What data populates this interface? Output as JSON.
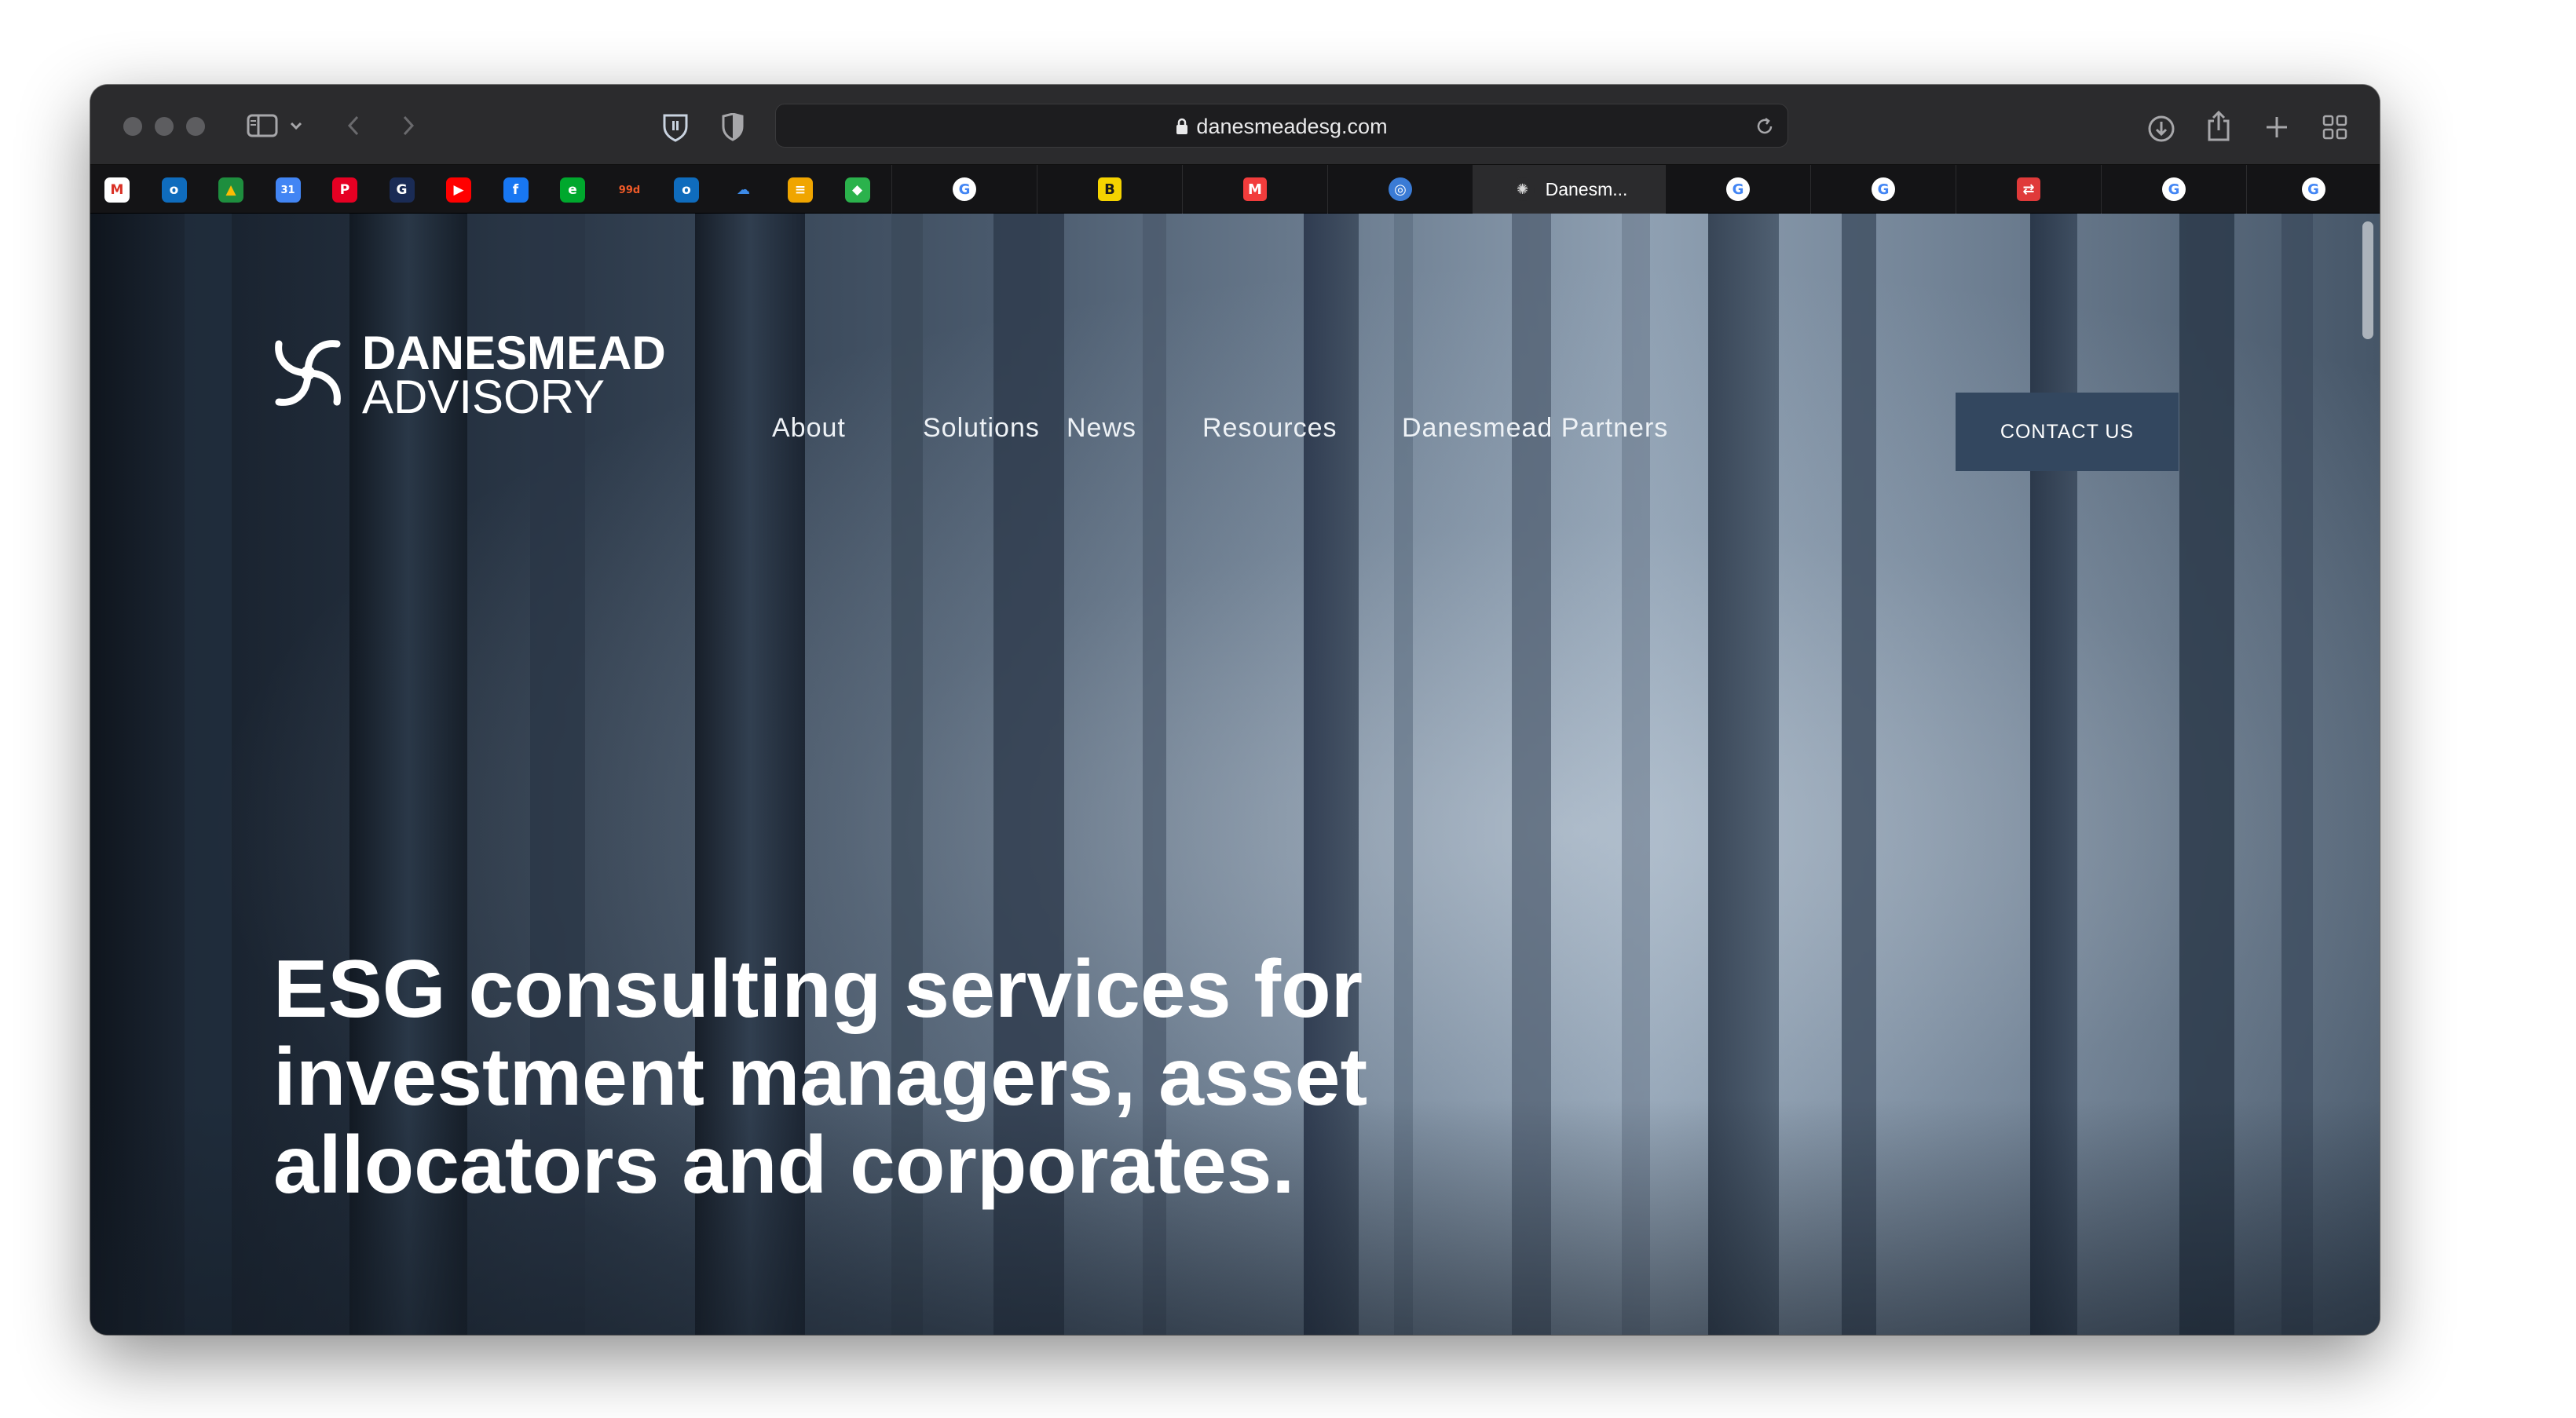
{
  "browser": {
    "url": "danesmeadesg.com",
    "active_tab_title": "Danesm..."
  },
  "bookmarks": [
    {
      "icon": "gmail-icon",
      "glyph": "M",
      "color": "#ffffff",
      "fg": "#d93025"
    },
    {
      "icon": "outlook-icon",
      "glyph": "o",
      "color": "#0f6cbd",
      "fg": "#ffffff"
    },
    {
      "icon": "google-drive-icon",
      "glyph": "▲",
      "color": "#1e8e3e",
      "fg": "#fbbc04"
    },
    {
      "icon": "google-calendar-icon",
      "glyph": "31",
      "color": "#4285f4",
      "fg": "#ffffff"
    },
    {
      "icon": "pinterest-icon",
      "glyph": "P",
      "color": "#e60023",
      "fg": "#ffffff"
    },
    {
      "icon": "g-circle-icon",
      "glyph": "G",
      "color": "#1a2b55",
      "fg": "#ffffff"
    },
    {
      "icon": "youtube-icon",
      "glyph": "▶",
      "color": "#ff0000",
      "fg": "#ffffff"
    },
    {
      "icon": "facebook-icon",
      "glyph": "f",
      "color": "#1877f2",
      "fg": "#ffffff"
    },
    {
      "icon": "evernote-icon",
      "glyph": "e",
      "color": "#00a82d",
      "fg": "#ffffff"
    },
    {
      "icon": "99designs-icon",
      "glyph": "99d",
      "color": "#141416",
      "fg": "#f05a28"
    },
    {
      "icon": "outlook-icon-2",
      "glyph": "o",
      "color": "#0f6cbd",
      "fg": "#ffffff"
    },
    {
      "icon": "onedrive-icon",
      "glyph": "☁",
      "color": "#141416",
      "fg": "#3d8be8"
    },
    {
      "icon": "stack-icon",
      "glyph": "≡",
      "color": "#f0a500",
      "fg": "#ffffff"
    },
    {
      "icon": "feedly-icon",
      "glyph": "◆",
      "color": "#2bb24c",
      "fg": "#ffffff"
    }
  ],
  "tabs": [
    {
      "icon": "google-icon",
      "glyph": "G",
      "active": false
    },
    {
      "icon": "basecamp-icon",
      "glyph": "B",
      "active": false
    },
    {
      "icon": "mixmax-icon",
      "glyph": "M",
      "active": false
    },
    {
      "icon": "target-icon",
      "glyph": "◎",
      "active": false
    },
    {
      "icon": "danesmead-icon",
      "glyph": "✺",
      "active": true
    },
    {
      "icon": "google-icon",
      "glyph": "G",
      "active": false
    },
    {
      "icon": "google-icon",
      "glyph": "G",
      "active": false
    },
    {
      "icon": "app-icon",
      "glyph": "⇄",
      "active": false
    },
    {
      "icon": "google-icon",
      "glyph": "G",
      "active": false
    },
    {
      "icon": "google-icon",
      "glyph": "G",
      "active": false
    }
  ],
  "site": {
    "logo_line1": "DANESMEAD",
    "logo_line2": "ADVISORY",
    "nav": [
      "About",
      "Solutions",
      "News",
      "Resources",
      "Danesmead Partners"
    ],
    "contact_label": "CONTACT US",
    "headline": "ESG consulting services for investment managers, asset allocators and corporates."
  },
  "colors": {
    "contact_bg": "#33475f",
    "toolbar_bg": "#2b2b2d",
    "tabbar_bg": "#141416"
  }
}
